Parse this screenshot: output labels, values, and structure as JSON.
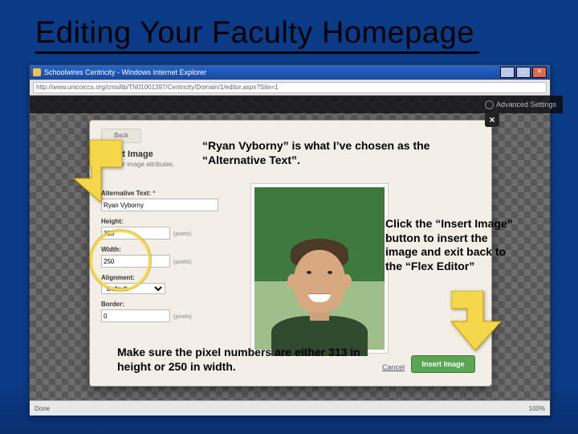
{
  "slide": {
    "title": "Editing Your Faculty Homepage"
  },
  "browser": {
    "window_title": "Schoolwires Centricity - Windows Internet Explorer",
    "url": "http://www.unicoiccs.org/cms/lib/TN01001397/Centricity/Domain/1/editor.aspx?Site=1",
    "status_done": "Done",
    "status_zoom": "100%",
    "win": {
      "min": "_",
      "max": "□",
      "close": "×"
    }
  },
  "editor_strip": {
    "title": "",
    "advanced": "Advanced Settings"
  },
  "dialog": {
    "close": "×",
    "back": "Back",
    "heading": "Insert Image",
    "sub": "Set your image attributes.",
    "labels": {
      "alt": "Alternative Text:",
      "height": "Height:",
      "width": "Width:",
      "align": "Alignment:",
      "border": "Border:"
    },
    "values": {
      "alt": "Ryan Vyborny",
      "height": "313",
      "width": "250",
      "align": "Default",
      "border": "0"
    },
    "pixels": "(pixels)",
    "req": "*",
    "insert": "Insert Image",
    "cancel": "Cancel"
  },
  "callouts": {
    "c1": "“Ryan Vyborny” is what I’ve chosen as the “Alternative Text”.",
    "c2": "Click the “Insert Image” button to insert the image and exit back to the “Flex Editor”",
    "c3": "Make sure the pixel numbers are either 313 in height or 250 in width."
  },
  "icons": {
    "back": "back-icon",
    "close": "close-icon",
    "gear": "gear-icon",
    "logo": "schoolwires-icon"
  }
}
